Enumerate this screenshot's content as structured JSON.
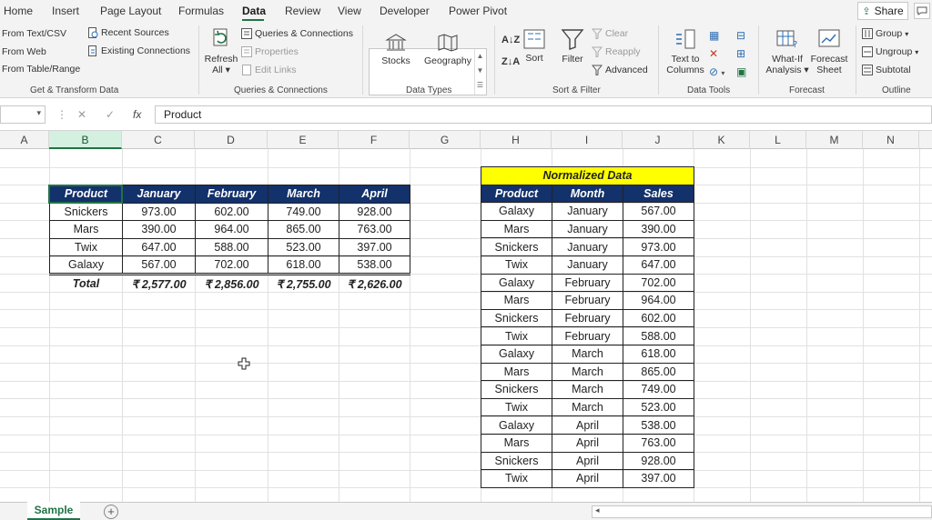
{
  "menu": {
    "tabs": [
      "Home",
      "Insert",
      "Page Layout",
      "Formulas",
      "Data",
      "Review",
      "View",
      "Developer",
      "Power Pivot"
    ],
    "active_tab": "Data",
    "share_label": "Share"
  },
  "ribbon": {
    "get_transform": {
      "items": [
        "From Text/CSV",
        "From Web",
        "From Table/Range",
        "Recent Sources",
        "Existing Connections"
      ],
      "label": "Get & Transform Data"
    },
    "queries": {
      "refresh_label": "Refresh",
      "refresh_sub": "All",
      "items": [
        "Queries & Connections",
        "Properties",
        "Edit Links"
      ],
      "label": "Queries & Connections"
    },
    "data_types": {
      "items": [
        "Stocks",
        "Geography"
      ],
      "label": "Data Types"
    },
    "sort_filter": {
      "sort_label": "Sort",
      "filter_label": "Filter",
      "items": [
        "Clear",
        "Reapply",
        "Advanced"
      ],
      "label": "Sort & Filter"
    },
    "data_tools": {
      "ttc_line1": "Text to",
      "ttc_line2": "Columns",
      "label": "Data Tools"
    },
    "forecast": {
      "whatif_line1": "What-If",
      "whatif_line2": "Analysis",
      "sheet_line1": "Forecast",
      "sheet_line2": "Sheet",
      "label": "Forecast"
    },
    "outline": {
      "items": [
        "Group",
        "Ungroup",
        "Subtotal"
      ],
      "label": "Outline"
    }
  },
  "formula_bar": {
    "fx": "fx",
    "value": "Product"
  },
  "columns": [
    "A",
    "B",
    "C",
    "D",
    "E",
    "F",
    "G",
    "H",
    "I",
    "J",
    "K",
    "L",
    "M",
    "N"
  ],
  "selected_column": "B",
  "source_table": {
    "headers": [
      "Product",
      "January",
      "February",
      "March",
      "April"
    ],
    "rows": [
      [
        "Snickers",
        "973.00",
        "602.00",
        "749.00",
        "928.00"
      ],
      [
        "Mars",
        "390.00",
        "964.00",
        "865.00",
        "763.00"
      ],
      [
        "Twix",
        "647.00",
        "588.00",
        "523.00",
        "397.00"
      ],
      [
        "Galaxy",
        "567.00",
        "702.00",
        "618.00",
        "538.00"
      ]
    ],
    "total": [
      "Total",
      "₹ 2,577.00",
      "₹ 2,856.00",
      "₹ 2,755.00",
      "₹ 2,626.00"
    ]
  },
  "normalized_table": {
    "title": "Normalized Data",
    "headers": [
      "Product",
      "Month",
      "Sales"
    ],
    "rows": [
      [
        "Galaxy",
        "January",
        "567.00"
      ],
      [
        "Mars",
        "January",
        "390.00"
      ],
      [
        "Snickers",
        "January",
        "973.00"
      ],
      [
        "Twix",
        "January",
        "647.00"
      ],
      [
        "Galaxy",
        "February",
        "702.00"
      ],
      [
        "Mars",
        "February",
        "964.00"
      ],
      [
        "Snickers",
        "February",
        "602.00"
      ],
      [
        "Twix",
        "February",
        "588.00"
      ],
      [
        "Galaxy",
        "March",
        "618.00"
      ],
      [
        "Mars",
        "March",
        "865.00"
      ],
      [
        "Snickers",
        "March",
        "749.00"
      ],
      [
        "Twix",
        "March",
        "523.00"
      ],
      [
        "Galaxy",
        "April",
        "538.00"
      ],
      [
        "Mars",
        "April",
        "763.00"
      ],
      [
        "Snickers",
        "April",
        "928.00"
      ],
      [
        "Twix",
        "April",
        "397.00"
      ]
    ]
  },
  "sheet_tabs": [
    "Sample"
  ],
  "colors": {
    "header_fill": "#13316b",
    "title_fill": "#ffff00",
    "accent": "#217346"
  }
}
